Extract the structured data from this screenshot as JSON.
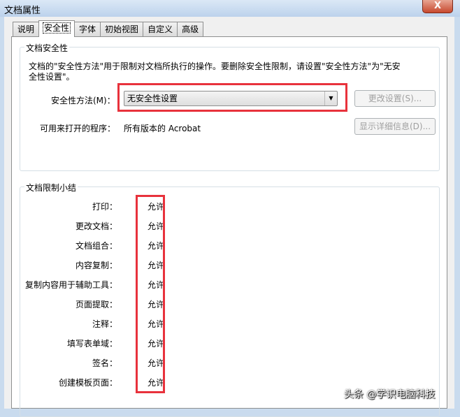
{
  "window": {
    "title": "文档属性",
    "close_label": "X"
  },
  "tabs": [
    "说明",
    "安全性",
    "字体",
    "初始视图",
    "自定义",
    "高级"
  ],
  "active_tab": 1,
  "security": {
    "group_title": "文档安全性",
    "description": "文档的\"安全性方法\"用于限制对文档所执行的操作。要删除安全性限制，请设置\"安全性方法\"为\"无安全性设置\"。",
    "method_label": "安全性方法(M)：",
    "method_value": "无安全性设置",
    "change_settings_button": "更改设置(S)...",
    "open_with_label": "可用来打开的程序：",
    "open_with_value": "所有版本的 Acrobat",
    "show_details_button": "显示详细信息(D)..."
  },
  "restrictions": {
    "group_title": "文档限制小结",
    "rows": [
      {
        "label": "打印：",
        "value": "允许"
      },
      {
        "label": "更改文档：",
        "value": "允许"
      },
      {
        "label": "文档组合：",
        "value": "允许"
      },
      {
        "label": "内容复制：",
        "value": "允许"
      },
      {
        "label": "复制内容用于辅助工具：",
        "value": "允许"
      },
      {
        "label": "页面提取：",
        "value": "允许"
      },
      {
        "label": "注释：",
        "value": "允许"
      },
      {
        "label": "填写表单域：",
        "value": "允许"
      },
      {
        "label": "签名：",
        "value": "允许"
      },
      {
        "label": "创建模板页面：",
        "value": "允许"
      }
    ]
  },
  "watermark": "头条 @学识电脑科技",
  "colors": {
    "highlight": "#e8323c"
  }
}
